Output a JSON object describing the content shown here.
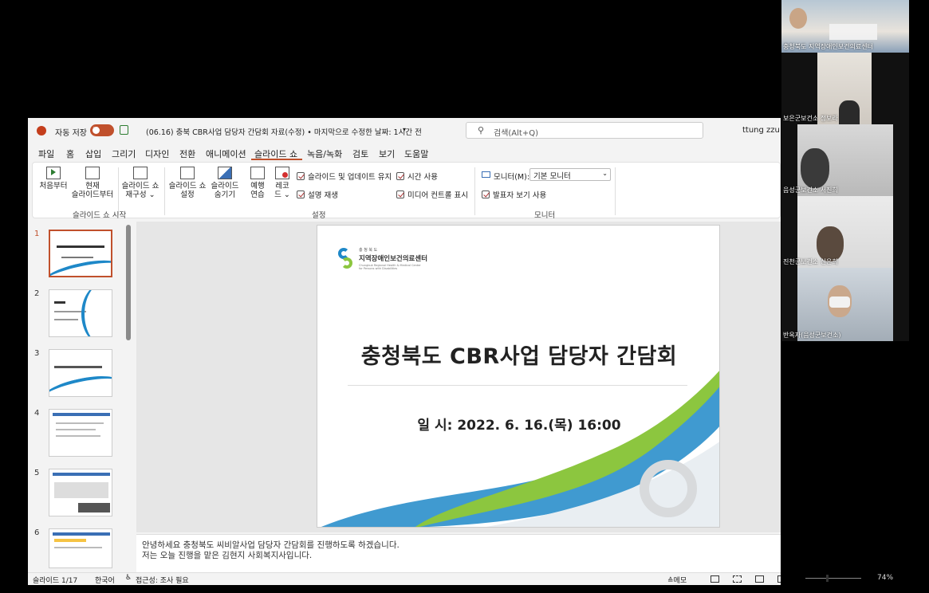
{
  "titlebar": {
    "autosave_label": "자동 저장",
    "autosave_state": "켬",
    "doc_title": "(06.16) 충북 CBR사업 담당자 간담회 자료(수정) • 마지막으로 수정한 날짜: 1시간 전",
    "search_placeholder": "검색(Alt+Q)",
    "user": "ttung zzu"
  },
  "menu": [
    "파일",
    "홈",
    "삽입",
    "그리기",
    "디자인",
    "전환",
    "애니메이션",
    "슬라이드 쇼",
    "녹음/녹화",
    "검토",
    "보기",
    "도움말"
  ],
  "ribbon": {
    "from_start": "처음부터",
    "from_current_1": "현재",
    "from_current_2": "슬라이드부터",
    "custom_1": "슬라이드 쇼",
    "custom_2": "재구성 ⌄",
    "setup_1": "슬라이드 쇼",
    "setup_2": "설정",
    "hide_1": "슬라이드",
    "hide_2": "숨기기",
    "rehearse_1": "예행",
    "rehearse_2": "연습",
    "record_1": "레코",
    "record_2": "드 ⌄",
    "chk_keep_updated": "슬라이드 및 업데이트 유지",
    "chk_timings": "시간 사용",
    "chk_narration": "설명 재생",
    "chk_media": "미디어 컨트롤 표시",
    "monitor_label": "모니터(M):",
    "monitor_value": "기본 모니터",
    "chk_presenter": "발표자 보기 사용",
    "group_start": "슬라이드 쇼 시작",
    "group_setup": "설정",
    "group_monitor": "모니터"
  },
  "thumbnails": [
    "1",
    "2",
    "3",
    "4",
    "5",
    "6"
  ],
  "slide": {
    "org_small": "충 청 북 도",
    "org_name": "지역장애인보건의료센터",
    "org_en": "Chungbuk Regional Health & Medical Center for Persons with Disabilities",
    "title": "충청북도 CBR사업 담당자 간담회",
    "date_line": "일 시: 2022. 6. 16.(목) 16:00"
  },
  "notes": {
    "line1": "안녕하세요 충청북도 씨비알사업 담당자 간담회를 진행하도록 하겠습니다.",
    "line2": "저는 오늘 진행을 맡은 김현지 사회복지사입니다."
  },
  "status": {
    "slide_count": "슬라이드 1/17",
    "language": "한국어",
    "accessibility": "접근성: 조사 필요",
    "notes_btn": "≙메모",
    "zoom": "74%"
  },
  "participants": [
    {
      "name": "충청북도 지역장애인보건의료센터"
    },
    {
      "name": "보은군보건소 정보라"
    },
    {
      "name": "음성군보건소 서진희"
    },
    {
      "name": "진천군보건소 신은희"
    },
    {
      "name": "반옥자(음성군보건소)"
    }
  ],
  "colors": {
    "accent": "#c0502c",
    "slide_green": "#8cc63f",
    "slide_blue": "#1e88c8"
  }
}
